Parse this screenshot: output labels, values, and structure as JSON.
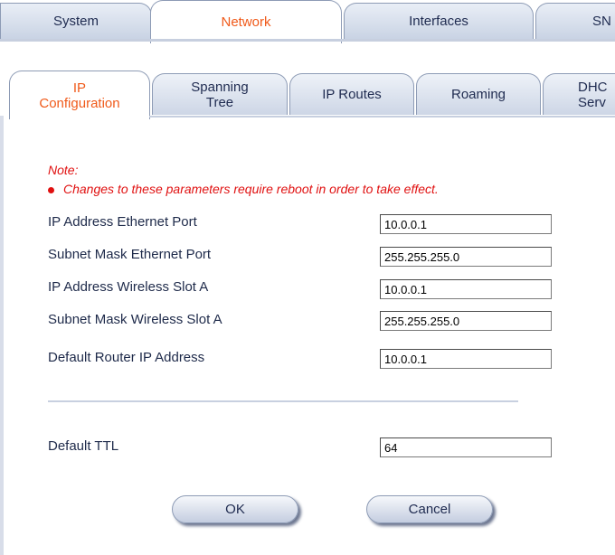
{
  "top_tabs": [
    {
      "label": "System"
    },
    {
      "label": "Network"
    },
    {
      "label": "Interfaces"
    },
    {
      "label": "SN"
    }
  ],
  "sub_tabs": [
    {
      "line1": "IP",
      "line2": "Configuration"
    },
    {
      "line1": "Spanning",
      "line2": "Tree"
    },
    {
      "line1": "IP Routes",
      "line2": ""
    },
    {
      "line1": "Roaming",
      "line2": ""
    },
    {
      "line1": "DHC",
      "line2": "Serv"
    }
  ],
  "note": {
    "title": "Note:",
    "text": "Changes to these parameters require reboot in order to take effect."
  },
  "fields": [
    {
      "label": "IP Address Ethernet Port",
      "value": "10.0.0.1"
    },
    {
      "label": "Subnet Mask Ethernet Port",
      "value": "255.255.255.0"
    },
    {
      "label": "IP Address Wireless Slot A",
      "value": "10.0.0.1"
    },
    {
      "label": "Subnet Mask Wireless Slot A",
      "value": "255.255.255.0"
    },
    {
      "label": "Default Router IP Address",
      "value": "10.0.0.1"
    },
    {
      "label": "Default TTL",
      "value": "64"
    }
  ],
  "buttons": {
    "ok": "OK",
    "cancel": "Cancel"
  },
  "colors": {
    "active_tab_text": "#f05a1a",
    "note_red": "#e01010"
  }
}
